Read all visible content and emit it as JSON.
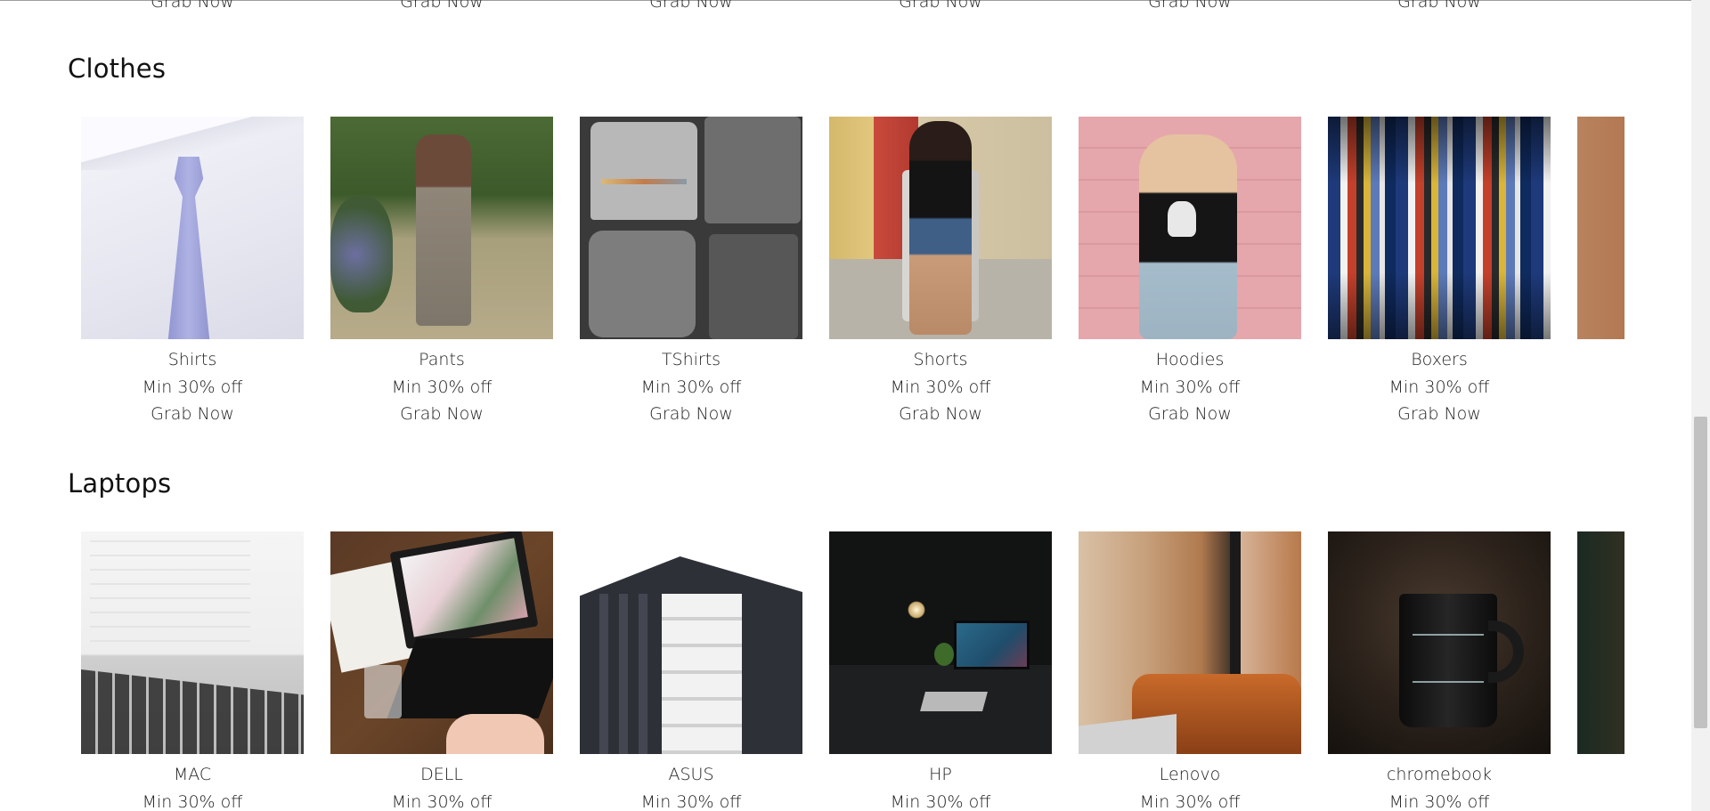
{
  "previous_section": {
    "cta_labels": [
      "Grab Now",
      "Grab Now",
      "Grab Now",
      "Grab Now",
      "Grab Now",
      "Grab Now"
    ]
  },
  "sections": [
    {
      "title": "Clothes",
      "items": [
        {
          "name": "Shirts",
          "offer": "Min 30% off",
          "cta": "Grab Now"
        },
        {
          "name": "Pants",
          "offer": "Min 30% off",
          "cta": "Grab Now"
        },
        {
          "name": "TShirts",
          "offer": "Min 30% off",
          "cta": "Grab Now"
        },
        {
          "name": "Shorts",
          "offer": "Min 30% off",
          "cta": "Grab Now"
        },
        {
          "name": "Hoodies",
          "offer": "Min 30% off",
          "cta": "Grab Now"
        },
        {
          "name": "Boxers",
          "offer": "Min 30% off",
          "cta": "Grab Now"
        }
      ]
    },
    {
      "title": "Laptops",
      "items": [
        {
          "name": "MAC",
          "offer": "Min 30% off"
        },
        {
          "name": "DELL",
          "offer": "Min 30% off"
        },
        {
          "name": "ASUS",
          "offer": "Min 30% off"
        },
        {
          "name": "HP",
          "offer": "Min 30% off"
        },
        {
          "name": "Lenovo",
          "offer": "Min 30% off"
        },
        {
          "name": "chromebook",
          "offer": "Min 30% off"
        }
      ]
    }
  ]
}
